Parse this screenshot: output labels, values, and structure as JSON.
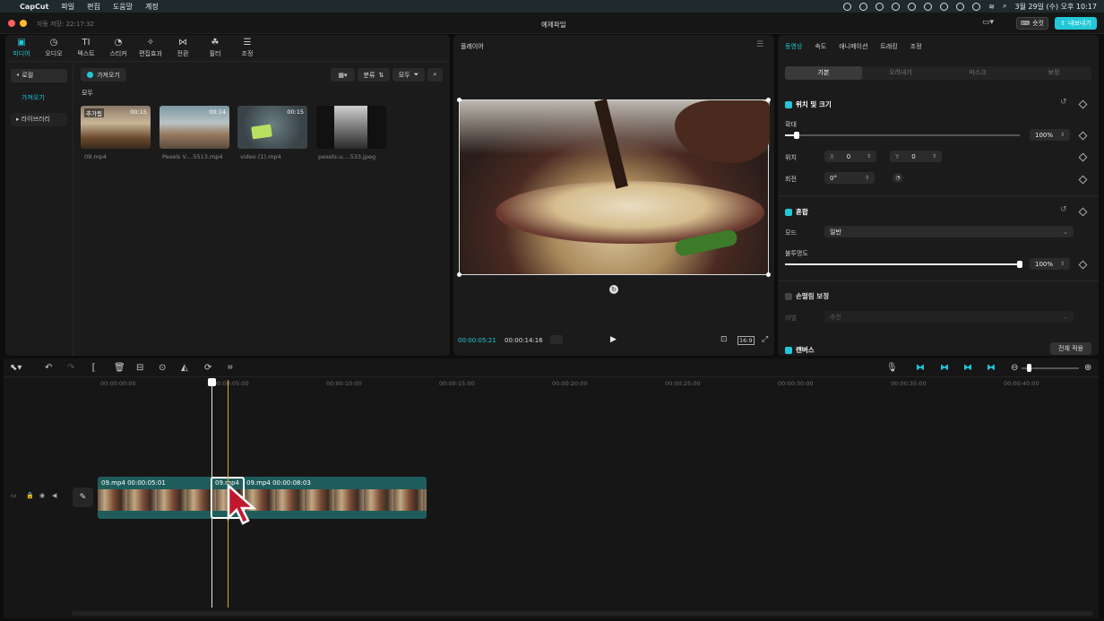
{
  "menubar": {
    "apple": "",
    "app": "CapCut",
    "items": [
      "파일",
      "편집",
      "도움말",
      "계정"
    ],
    "datetime": "3월 29일 (수) 오후 10:17"
  },
  "titlebar": {
    "autosave": "자동 저장: 22:17:32",
    "title": "예제파일",
    "shortcut": "숏컷",
    "export": "내보내기"
  },
  "media_tabs": [
    {
      "label": "미디어",
      "icon": "media-icon"
    },
    {
      "label": "오디오",
      "icon": "audio-icon"
    },
    {
      "label": "텍스트",
      "icon": "text-icon"
    },
    {
      "label": "스티커",
      "icon": "sticker-icon"
    },
    {
      "label": "편집효과",
      "icon": "effects-icon"
    },
    {
      "label": "전환",
      "icon": "transition-icon"
    },
    {
      "label": "필터",
      "icon": "filter-icon"
    },
    {
      "label": "조정",
      "icon": "adjust-icon"
    }
  ],
  "sidebar": {
    "local": "• 로컬",
    "import": "가져오기",
    "library": "▸ 라이브러리"
  },
  "media": {
    "import_btn": "가져오기",
    "sort": "분류",
    "all_filter": "모두",
    "section": "모두",
    "items": [
      {
        "name": "09.mp4",
        "duration": "00:15",
        "badge": "추가됨"
      },
      {
        "name": "Pexels V....5513.mp4",
        "duration": "00:14",
        "badge": ""
      },
      {
        "name": "video (1).mp4",
        "duration": "00:15",
        "badge": ""
      },
      {
        "name": "pexels-u....533.jpeg",
        "duration": "",
        "badge": ""
      }
    ]
  },
  "player": {
    "title": "플레이어",
    "current": "00:00:05:21",
    "total": "00:00:14:16",
    "ratio": "16:9"
  },
  "props": {
    "tabs": [
      "동영상",
      "속도",
      "애니메이션",
      "트래킹",
      "조정"
    ],
    "subtabs": [
      "기본",
      "오려내기",
      "마스크",
      "보정"
    ],
    "pos_size": "위치 및 크기",
    "scale": "확대",
    "scale_value": "100%",
    "position": "위치",
    "x_label": "X",
    "x_value": "0",
    "y_label": "Y",
    "y_value": "0",
    "rotate": "회전",
    "rotate_value": "0°",
    "blend": "혼합",
    "mode": "모드",
    "mode_value": "일반",
    "opacity": "불투명도",
    "opacity_value": "100%",
    "stabilize": "손떨림 보정",
    "stabilize_level": "레벨",
    "stabilize_value": "추천",
    "canvas": "캔버스",
    "apply_all": "전체 적용",
    "scale_level": 0.05,
    "opacity_level": 1.0
  },
  "timeline": {
    "ticks": [
      "00:00:00:00",
      "00:00:05:00",
      "00:00:10:00",
      "00:00:15:00",
      "00:00:20:00",
      "00:00:25:00",
      "00:00:30:00",
      "00:00:35:00",
      "00:00:40:00"
    ],
    "clip1": "09.mp4  00:00:05:01",
    "clip2": "09.mp4",
    "clip3": "09.mp4  00:00:08:03"
  },
  "colors": {
    "accent": "#22c8d8",
    "clip_bg": "#1e5d5c",
    "playhead": "#e0a830",
    "cursor": "#c0192e"
  }
}
